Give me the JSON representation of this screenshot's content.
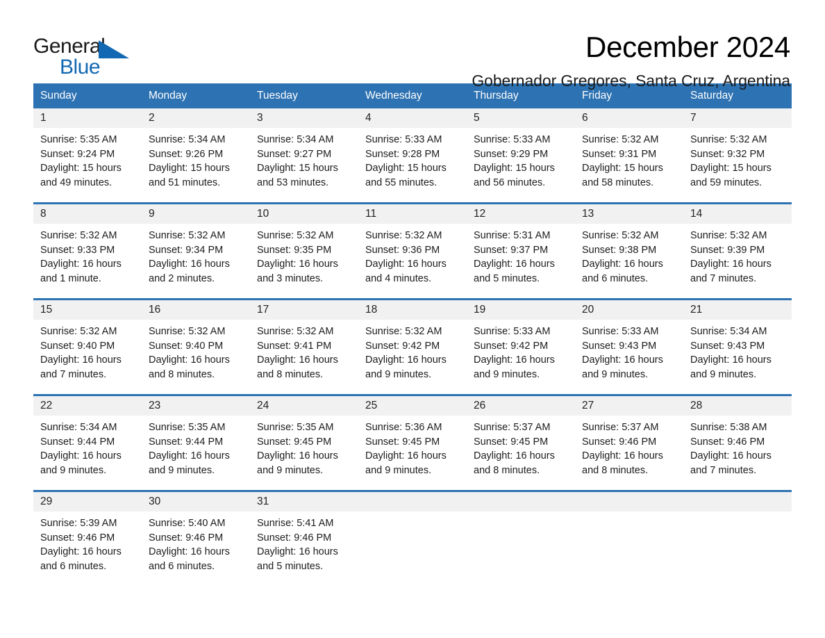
{
  "logo": {
    "word_one": "General",
    "word_two": "Blue",
    "triangle_color": "#1268b3"
  },
  "header": {
    "title": "December 2024",
    "subtitle": "Gobernador Gregores, Santa Cruz, Argentina"
  },
  "theme": {
    "header_blue": "#2d72b2",
    "date_band_gray": "#f1f1f1",
    "text_dark": "#1c1c1c"
  },
  "calendar": {
    "weekday_headers": [
      "Sunday",
      "Monday",
      "Tuesday",
      "Wednesday",
      "Thursday",
      "Friday",
      "Saturday"
    ],
    "weeks": [
      {
        "dates": [
          "1",
          "2",
          "3",
          "4",
          "5",
          "6",
          "7"
        ],
        "cells": [
          {
            "sunrise": "Sunrise: 5:35 AM",
            "sunset": "Sunset: 9:24 PM",
            "daylight_1": "Daylight: 15 hours",
            "daylight_2": "and 49 minutes."
          },
          {
            "sunrise": "Sunrise: 5:34 AM",
            "sunset": "Sunset: 9:26 PM",
            "daylight_1": "Daylight: 15 hours",
            "daylight_2": "and 51 minutes."
          },
          {
            "sunrise": "Sunrise: 5:34 AM",
            "sunset": "Sunset: 9:27 PM",
            "daylight_1": "Daylight: 15 hours",
            "daylight_2": "and 53 minutes."
          },
          {
            "sunrise": "Sunrise: 5:33 AM",
            "sunset": "Sunset: 9:28 PM",
            "daylight_1": "Daylight: 15 hours",
            "daylight_2": "and 55 minutes."
          },
          {
            "sunrise": "Sunrise: 5:33 AM",
            "sunset": "Sunset: 9:29 PM",
            "daylight_1": "Daylight: 15 hours",
            "daylight_2": "and 56 minutes."
          },
          {
            "sunrise": "Sunrise: 5:32 AM",
            "sunset": "Sunset: 9:31 PM",
            "daylight_1": "Daylight: 15 hours",
            "daylight_2": "and 58 minutes."
          },
          {
            "sunrise": "Sunrise: 5:32 AM",
            "sunset": "Sunset: 9:32 PM",
            "daylight_1": "Daylight: 15 hours",
            "daylight_2": "and 59 minutes."
          }
        ]
      },
      {
        "dates": [
          "8",
          "9",
          "10",
          "11",
          "12",
          "13",
          "14"
        ],
        "cells": [
          {
            "sunrise": "Sunrise: 5:32 AM",
            "sunset": "Sunset: 9:33 PM",
            "daylight_1": "Daylight: 16 hours",
            "daylight_2": "and 1 minute."
          },
          {
            "sunrise": "Sunrise: 5:32 AM",
            "sunset": "Sunset: 9:34 PM",
            "daylight_1": "Daylight: 16 hours",
            "daylight_2": "and 2 minutes."
          },
          {
            "sunrise": "Sunrise: 5:32 AM",
            "sunset": "Sunset: 9:35 PM",
            "daylight_1": "Daylight: 16 hours",
            "daylight_2": "and 3 minutes."
          },
          {
            "sunrise": "Sunrise: 5:32 AM",
            "sunset": "Sunset: 9:36 PM",
            "daylight_1": "Daylight: 16 hours",
            "daylight_2": "and 4 minutes."
          },
          {
            "sunrise": "Sunrise: 5:31 AM",
            "sunset": "Sunset: 9:37 PM",
            "daylight_1": "Daylight: 16 hours",
            "daylight_2": "and 5 minutes."
          },
          {
            "sunrise": "Sunrise: 5:32 AM",
            "sunset": "Sunset: 9:38 PM",
            "daylight_1": "Daylight: 16 hours",
            "daylight_2": "and 6 minutes."
          },
          {
            "sunrise": "Sunrise: 5:32 AM",
            "sunset": "Sunset: 9:39 PM",
            "daylight_1": "Daylight: 16 hours",
            "daylight_2": "and 7 minutes."
          }
        ]
      },
      {
        "dates": [
          "15",
          "16",
          "17",
          "18",
          "19",
          "20",
          "21"
        ],
        "cells": [
          {
            "sunrise": "Sunrise: 5:32 AM",
            "sunset": "Sunset: 9:40 PM",
            "daylight_1": "Daylight: 16 hours",
            "daylight_2": "and 7 minutes."
          },
          {
            "sunrise": "Sunrise: 5:32 AM",
            "sunset": "Sunset: 9:40 PM",
            "daylight_1": "Daylight: 16 hours",
            "daylight_2": "and 8 minutes."
          },
          {
            "sunrise": "Sunrise: 5:32 AM",
            "sunset": "Sunset: 9:41 PM",
            "daylight_1": "Daylight: 16 hours",
            "daylight_2": "and 8 minutes."
          },
          {
            "sunrise": "Sunrise: 5:32 AM",
            "sunset": "Sunset: 9:42 PM",
            "daylight_1": "Daylight: 16 hours",
            "daylight_2": "and 9 minutes."
          },
          {
            "sunrise": "Sunrise: 5:33 AM",
            "sunset": "Sunset: 9:42 PM",
            "daylight_1": "Daylight: 16 hours",
            "daylight_2": "and 9 minutes."
          },
          {
            "sunrise": "Sunrise: 5:33 AM",
            "sunset": "Sunset: 9:43 PM",
            "daylight_1": "Daylight: 16 hours",
            "daylight_2": "and 9 minutes."
          },
          {
            "sunrise": "Sunrise: 5:34 AM",
            "sunset": "Sunset: 9:43 PM",
            "daylight_1": "Daylight: 16 hours",
            "daylight_2": "and 9 minutes."
          }
        ]
      },
      {
        "dates": [
          "22",
          "23",
          "24",
          "25",
          "26",
          "27",
          "28"
        ],
        "cells": [
          {
            "sunrise": "Sunrise: 5:34 AM",
            "sunset": "Sunset: 9:44 PM",
            "daylight_1": "Daylight: 16 hours",
            "daylight_2": "and 9 minutes."
          },
          {
            "sunrise": "Sunrise: 5:35 AM",
            "sunset": "Sunset: 9:44 PM",
            "daylight_1": "Daylight: 16 hours",
            "daylight_2": "and 9 minutes."
          },
          {
            "sunrise": "Sunrise: 5:35 AM",
            "sunset": "Sunset: 9:45 PM",
            "daylight_1": "Daylight: 16 hours",
            "daylight_2": "and 9 minutes."
          },
          {
            "sunrise": "Sunrise: 5:36 AM",
            "sunset": "Sunset: 9:45 PM",
            "daylight_1": "Daylight: 16 hours",
            "daylight_2": "and 9 minutes."
          },
          {
            "sunrise": "Sunrise: 5:37 AM",
            "sunset": "Sunset: 9:45 PM",
            "daylight_1": "Daylight: 16 hours",
            "daylight_2": "and 8 minutes."
          },
          {
            "sunrise": "Sunrise: 5:37 AM",
            "sunset": "Sunset: 9:46 PM",
            "daylight_1": "Daylight: 16 hours",
            "daylight_2": "and 8 minutes."
          },
          {
            "sunrise": "Sunrise: 5:38 AM",
            "sunset": "Sunset: 9:46 PM",
            "daylight_1": "Daylight: 16 hours",
            "daylight_2": "and 7 minutes."
          }
        ]
      },
      {
        "dates": [
          "29",
          "30",
          "31",
          "",
          "",
          "",
          ""
        ],
        "cells": [
          {
            "sunrise": "Sunrise: 5:39 AM",
            "sunset": "Sunset: 9:46 PM",
            "daylight_1": "Daylight: 16 hours",
            "daylight_2": "and 6 minutes."
          },
          {
            "sunrise": "Sunrise: 5:40 AM",
            "sunset": "Sunset: 9:46 PM",
            "daylight_1": "Daylight: 16 hours",
            "daylight_2": "and 6 minutes."
          },
          {
            "sunrise": "Sunrise: 5:41 AM",
            "sunset": "Sunset: 9:46 PM",
            "daylight_1": "Daylight: 16 hours",
            "daylight_2": "and 5 minutes."
          },
          {
            "sunrise": "",
            "sunset": "",
            "daylight_1": "",
            "daylight_2": ""
          },
          {
            "sunrise": "",
            "sunset": "",
            "daylight_1": "",
            "daylight_2": ""
          },
          {
            "sunrise": "",
            "sunset": "",
            "daylight_1": "",
            "daylight_2": ""
          },
          {
            "sunrise": "",
            "sunset": "",
            "daylight_1": "",
            "daylight_2": ""
          }
        ]
      }
    ]
  }
}
